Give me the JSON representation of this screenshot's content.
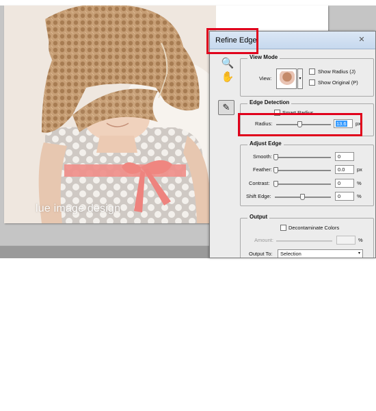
{
  "colors": {
    "workspace": "#c5c5c5",
    "dialog_bg": "#ececec",
    "highlight": "#e0001b",
    "selection": "#3399ff"
  },
  "image": {
    "watermark": "lue image design"
  },
  "dialog": {
    "title": "Refine Edge",
    "close_glyph": "✕",
    "tools": {
      "zoom_icon": "🔍",
      "hand_icon": "✋",
      "brush_icon": "✎"
    },
    "view_mode": {
      "title": "View Mode",
      "view_label": "View:",
      "dropdown_arrow": "▾",
      "show_radius": "Show Radius (J)",
      "show_original": "Show Original (P)"
    },
    "edge_detection": {
      "title": "Edge Detection",
      "smart_radius": "Smart Radius",
      "radius_label": "Radius:",
      "radius_value": "13.6",
      "radius_unit": "px"
    },
    "adjust_edge": {
      "title": "Adjust Edge",
      "smooth_label": "Smooth:",
      "smooth_value": "0",
      "feather_label": "Feather:",
      "feather_value": "0.0",
      "feather_unit": "px",
      "contrast_label": "Contrast:",
      "contrast_value": "0",
      "contrast_unit": "%",
      "shift_label": "Shift Edge:",
      "shift_value": "0",
      "shift_unit": "%"
    },
    "output": {
      "title": "Output",
      "decontaminate": "Decontaminate Colors",
      "amount_label": "Amount:",
      "amount_unit": "%",
      "output_to_label": "Output To:",
      "output_to_value": "Selection",
      "output_to_arrow": "▾"
    }
  }
}
